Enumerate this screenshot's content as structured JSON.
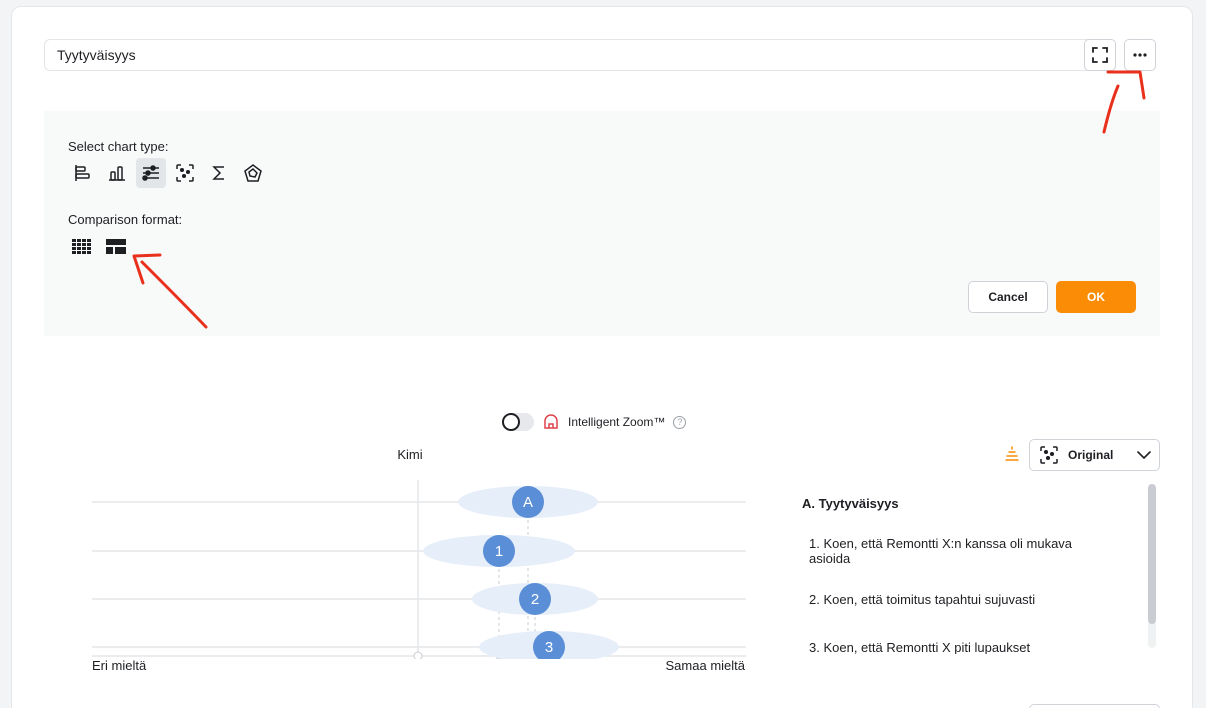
{
  "widget": {
    "title": "Tyytyväisyys"
  },
  "toolbar": {
    "fullscreen_icon": "fullscreen-icon",
    "more_icon": "ellipsis-icon"
  },
  "settings": {
    "chart_type_label": "Select chart type:",
    "chart_types": [
      "horizontal-bar",
      "vertical-bar",
      "sliders",
      "scatter",
      "sum",
      "radar"
    ],
    "active_chart_type": "sliders",
    "comparison_label": "Comparison format:",
    "comparison_formats": [
      "grid",
      "table"
    ],
    "cancel_label": "Cancel",
    "ok_label": "OK",
    "ok_color": "#fb8c05"
  },
  "zoom": {
    "label": "Intelligent Zoom™",
    "enabled": false,
    "help": "?"
  },
  "chart": {
    "series_label": "Kimi",
    "left_label": "Eri mieltä",
    "right_label": "Samaa mieltä",
    "dropdown_value": "Original",
    "markers": [
      {
        "label": "A"
      },
      {
        "label": "1"
      },
      {
        "label": "2"
      },
      {
        "label": "3"
      }
    ],
    "marker_color": "#5a8fd8"
  },
  "legend": {
    "heading": "A. Tyytyväisyys",
    "items": [
      "1. Koen, että Remontti X:n kanssa oli mukava asioida",
      "2. Koen, että toimitus tapahtui sujuvasti",
      "3. Koen, että Remontti X piti lupaukset"
    ]
  }
}
